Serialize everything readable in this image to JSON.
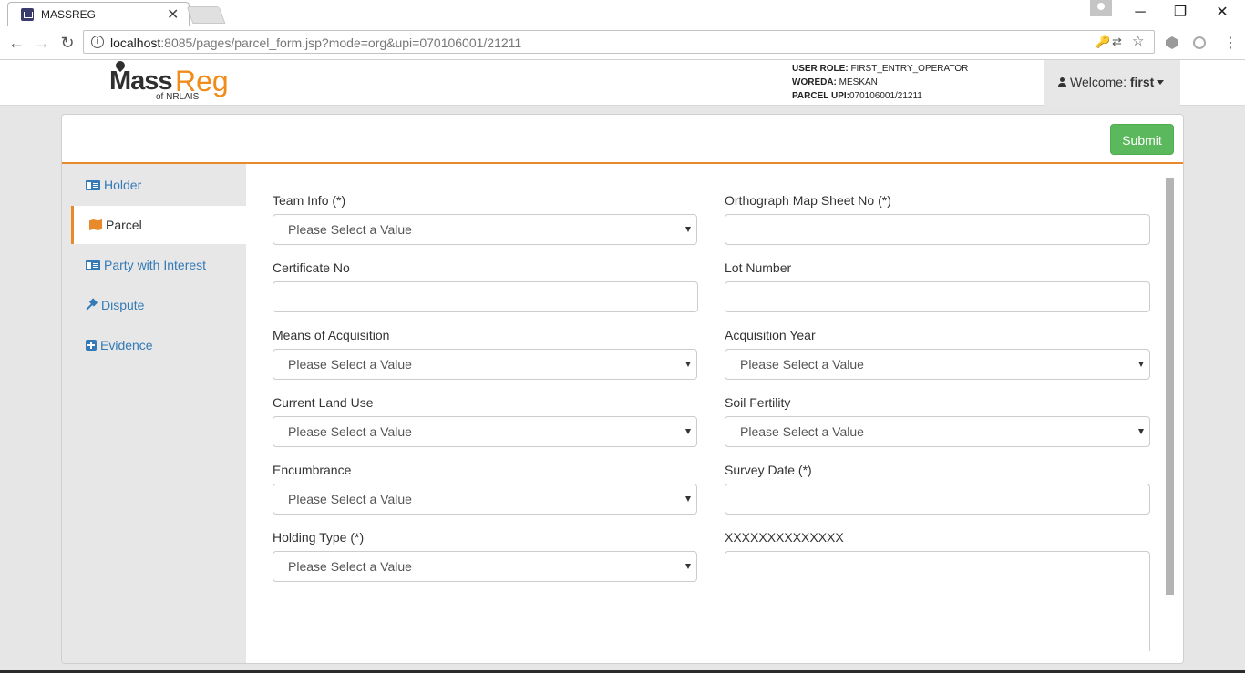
{
  "browser": {
    "tab_title": "MASSREG",
    "tab_close": "✕",
    "url_host": "localhost",
    "url_rest": ":8085/pages/parcel_form.jsp?mode=org&upi=070106001/21211",
    "window_minimize": "─",
    "window_maximize": "❐",
    "window_close": "✕"
  },
  "header": {
    "logo_mass": "Mass",
    "logo_reg": "Reg",
    "logo_sub": "of NRLAIS",
    "user_role_label": "USER ROLE:",
    "user_role_value": " FIRST_ENTRY_OPERATOR",
    "woreda_label": "WOREDA:",
    "woreda_value": " MESKAN",
    "parcel_upi_label": "PARCEL UPI:",
    "parcel_upi_value": "070106001/21211",
    "welcome_label": "Welcome: ",
    "welcome_user": "first"
  },
  "toolbar": {
    "submit_label": "Submit"
  },
  "sidebar": {
    "items": [
      {
        "label": "Holder",
        "icon": "id-card-icon"
      },
      {
        "label": "Parcel",
        "icon": "map-icon"
      },
      {
        "label": "Party with Interest",
        "icon": "id-card-icon"
      },
      {
        "label": "Dispute",
        "icon": "gavel-icon"
      },
      {
        "label": "Evidence",
        "icon": "plus-square-icon"
      }
    ],
    "active_index": 1
  },
  "form": {
    "team_info": {
      "label": "Team Info (*)",
      "value": "Please Select a Value"
    },
    "certificate_no": {
      "label": "Certificate No",
      "value": ""
    },
    "means_of_acquisition": {
      "label": "Means of Acquisition",
      "value": "Please Select a Value"
    },
    "current_land_use": {
      "label": "Current Land Use",
      "value": "Please Select a Value"
    },
    "encumbrance": {
      "label": "Encumbrance",
      "value": "Please Select a Value"
    },
    "holding_type": {
      "label": "Holding Type (*)",
      "value": "Please Select a Value"
    },
    "orthograph_map_sheet_no": {
      "label": "Orthograph Map Sheet No (*)",
      "value": ""
    },
    "lot_number": {
      "label": "Lot Number",
      "value": ""
    },
    "acquisition_year": {
      "label": "Acquisition Year",
      "value": "Please Select a Value"
    },
    "soil_fertility": {
      "label": "Soil Fertility",
      "value": "Please Select a Value"
    },
    "survey_date": {
      "label": "Survey Date (*)",
      "value": ""
    },
    "notes": {
      "label": "XXXXXXXXXXXXXX",
      "value": ""
    }
  },
  "colors": {
    "accent": "#e8892a",
    "link": "#337ab7",
    "submit": "#5cb85c"
  }
}
